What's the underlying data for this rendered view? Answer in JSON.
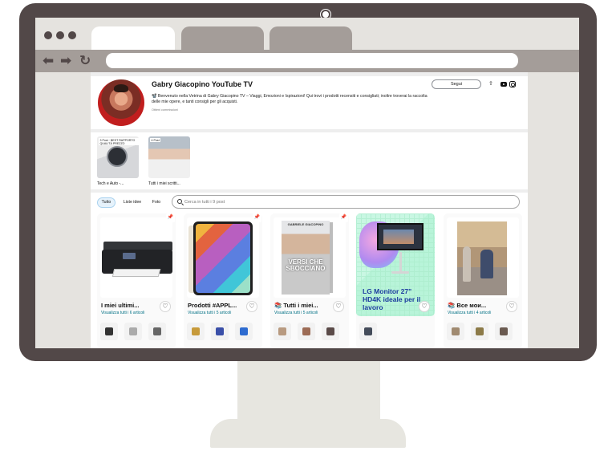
{
  "profile": {
    "name": "Gabry Giacopino YouTube TV",
    "description": "📽️ Benvenuto nella Vetrina di Gabry Giacopino TV – Viaggi, Emozioni e Ispirazioni! Qui trovi i prodotti recensiti e consigliati; inoltre troverai la raccolta delle mie opere, e tanti consigli per gli acquisti.",
    "note": "Ottieni commissioni",
    "follow_label": "Segui"
  },
  "collections": [
    {
      "label": "Tech e Auto -...",
      "badge": "3 Post · BEST RAPPORTO QUALITÀ PREZZO"
    },
    {
      "label": "Tutti i miei scritti...",
      "badge": "4 Post"
    }
  ],
  "filters": {
    "all": "Tutto",
    "ideas": "Liste idee",
    "photo": "Foto"
  },
  "search": {
    "placeholder": "Cerca in tutti i 9 post"
  },
  "posts": [
    {
      "title": "I miei ultimi...",
      "subtitle": "Visualizza tutti i 6 articoli"
    },
    {
      "title": "Prodotti #APPL...",
      "subtitle": "Visualizza tutti i 5 articoli"
    },
    {
      "title": "📚 Tutti i miei...",
      "subtitle": "Visualizza tutti i 5 articoli",
      "book_author": "GABRIELE GIACOPINO",
      "book_title": "VERSI CHE SBOCCIANO"
    },
    {
      "ad_text": "LG Monitor 27\" HD4K ideale per il lavoro"
    },
    {
      "title": "📚 Все мои...",
      "subtitle": "Visualizza tutti i 4 articoli"
    }
  ]
}
